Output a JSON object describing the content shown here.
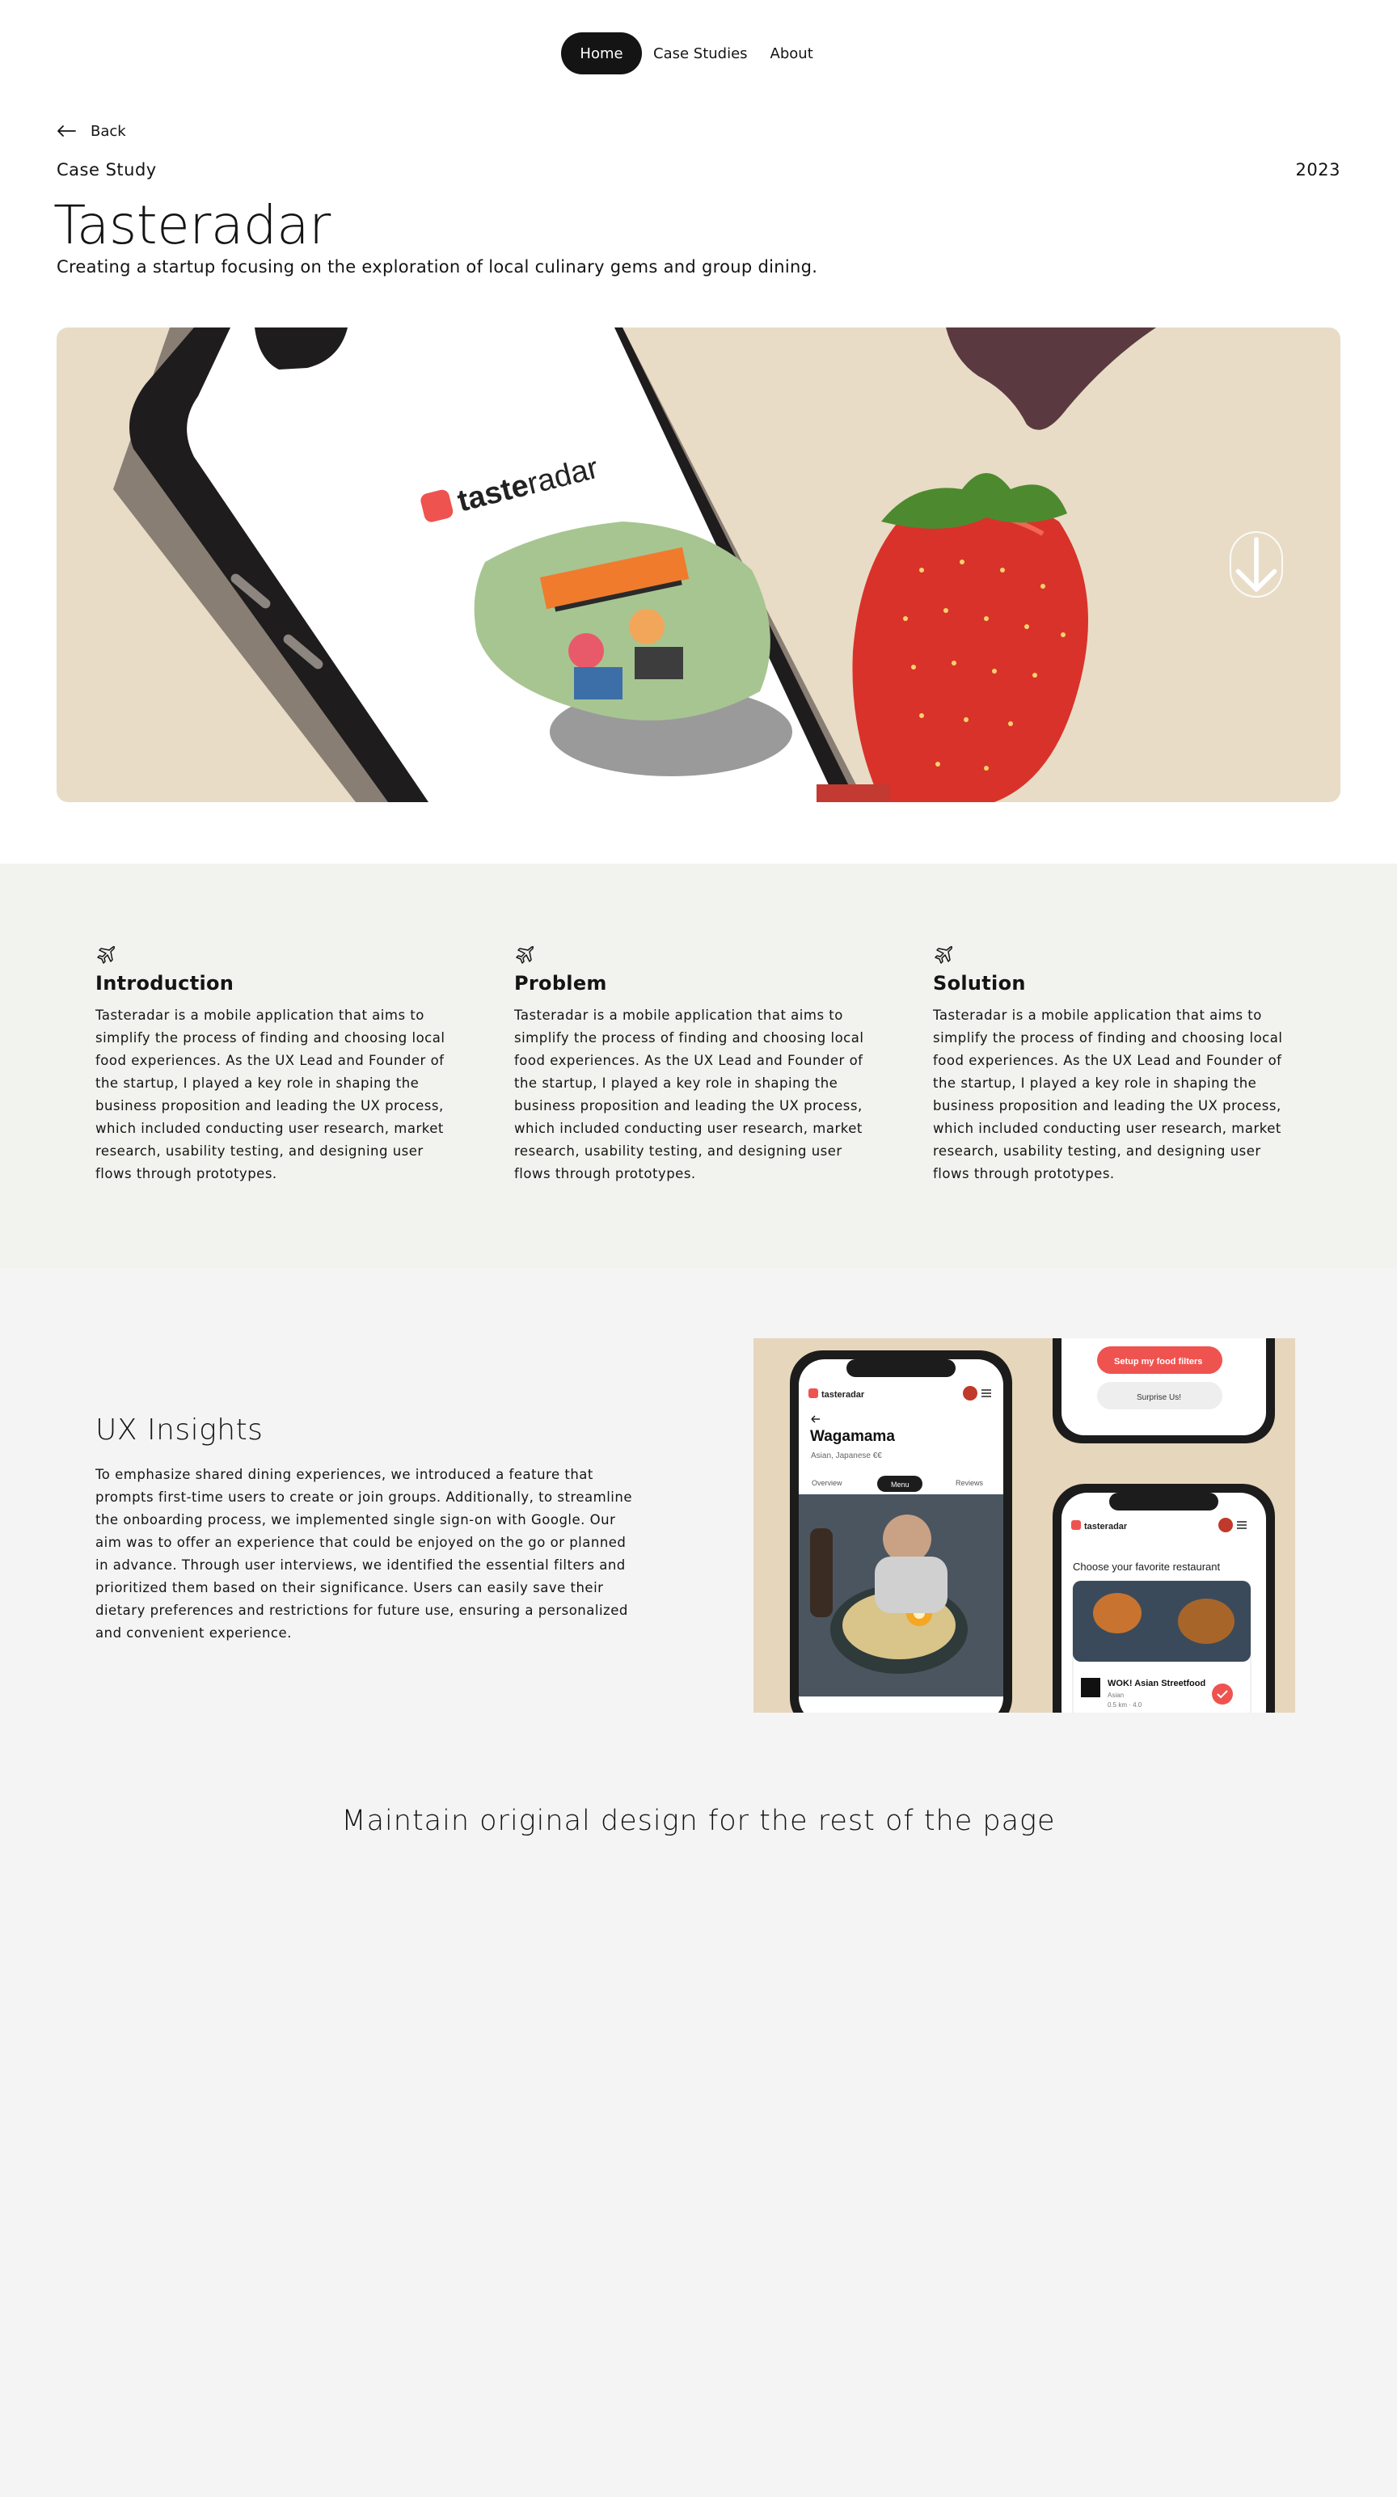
{
  "nav": {
    "items": [
      {
        "label": "Home",
        "active": true
      },
      {
        "label": "Case Studies",
        "active": false
      },
      {
        "label": "About",
        "active": false
      }
    ]
  },
  "header": {
    "back_label": "Back",
    "eyebrow": "Case Study",
    "year": "2023",
    "title": "Tasteradar",
    "subtitle": "Creating a startup focusing on the exploration of local culinary gems and group dining."
  },
  "hero": {
    "brand_logo_text": "tasteradar",
    "background_color": "#e8dcc6",
    "scroll_icon": "arrow-down-icon"
  },
  "sections": [
    {
      "icon": "airplane-icon",
      "title": "Introduction",
      "body": "Tasteradar is a mobile application that aims to simplify the process of finding and choosing local food experiences. As the UX Lead and Founder of the startup, I played a key role in shaping the business proposition and leading the UX process, which included conducting user research, market research, usability testing, and designing user flows through prototypes."
    },
    {
      "icon": "airplane-icon",
      "title": "Problem",
      "body": "Tasteradar is a mobile application that aims to simplify the process of finding and choosing local food experiences. As the UX Lead and Founder of the startup, I played a key role in shaping the business proposition and leading the UX process, which included conducting user research, market research, usability testing, and designing user flows through prototypes."
    },
    {
      "icon": "airplane-icon",
      "title": "Solution",
      "body": "Tasteradar is a mobile application that aims to simplify the process of finding and choosing local food experiences. As the UX Lead and Founder of the startup, I played a key role in shaping the business proposition and leading the UX process, which included conducting user research, market research, usability testing, and designing user flows through prototypes."
    }
  ],
  "ux": {
    "title": "UX Insights",
    "body": "To emphasize shared dining experiences, we introduced a feature that prompts first-time users to create or join groups. Additionally, to streamline the onboarding process, we implemented single sign-on with Google. Our aim was to offer an experience that could be enjoyed on the go or planned in advance. Through user interviews, we identified the essential filters and prioritized them based on their significance. Users can easily save their dietary preferences and restrictions for future use, ensuring a personalized and convenient experience.",
    "mockup": {
      "logo_text": "tasteradar",
      "restaurant_name": "Wagamama",
      "restaurant_meta": "Asian, Japanese   €€",
      "tabs": [
        "Overview",
        "Menu",
        "Reviews"
      ],
      "active_tab": "Menu",
      "filters_button": "Setup my food filters",
      "surprise_button": "Surprise Us!",
      "choose_heading": "Choose your favorite restaurant",
      "card_name": "WOK! Asian Streetfood",
      "card_meta_1": "Asian",
      "card_meta_2": "0.5 km · 4.0",
      "accent_color": "#ef5350"
    }
  },
  "footer_note": "Maintain original design for the rest of the page"
}
